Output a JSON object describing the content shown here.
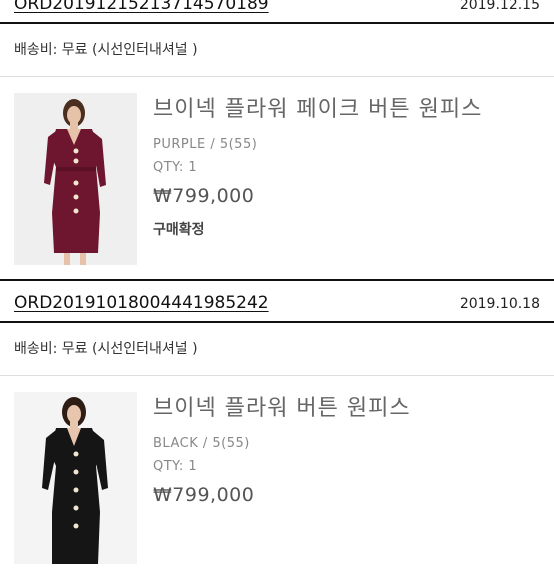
{
  "orders": [
    {
      "order_no": "ORD20191215213714570189",
      "date": "2019.12.15",
      "shipping": "배송비: 무료 (시선인터내셔널 )",
      "product": {
        "name": "브이넥 플라워 페이크 버튼 원피스",
        "option": "PURPLE / 5(55)",
        "qty": "QTY: 1",
        "price": "₩799,000",
        "status": "구매확정",
        "dress_color": "#6e1630"
      }
    },
    {
      "order_no": "ORD20191018004441985242",
      "date": "2019.10.18",
      "shipping": "배송비: 무료 (시선인터내셔널 )",
      "product": {
        "name": "브이넥 플라워 버튼 원피스",
        "option": "BLACK / 5(55)",
        "qty": "QTY: 1",
        "price": "₩799,000",
        "status": "",
        "dress_color": "#151515"
      }
    }
  ]
}
